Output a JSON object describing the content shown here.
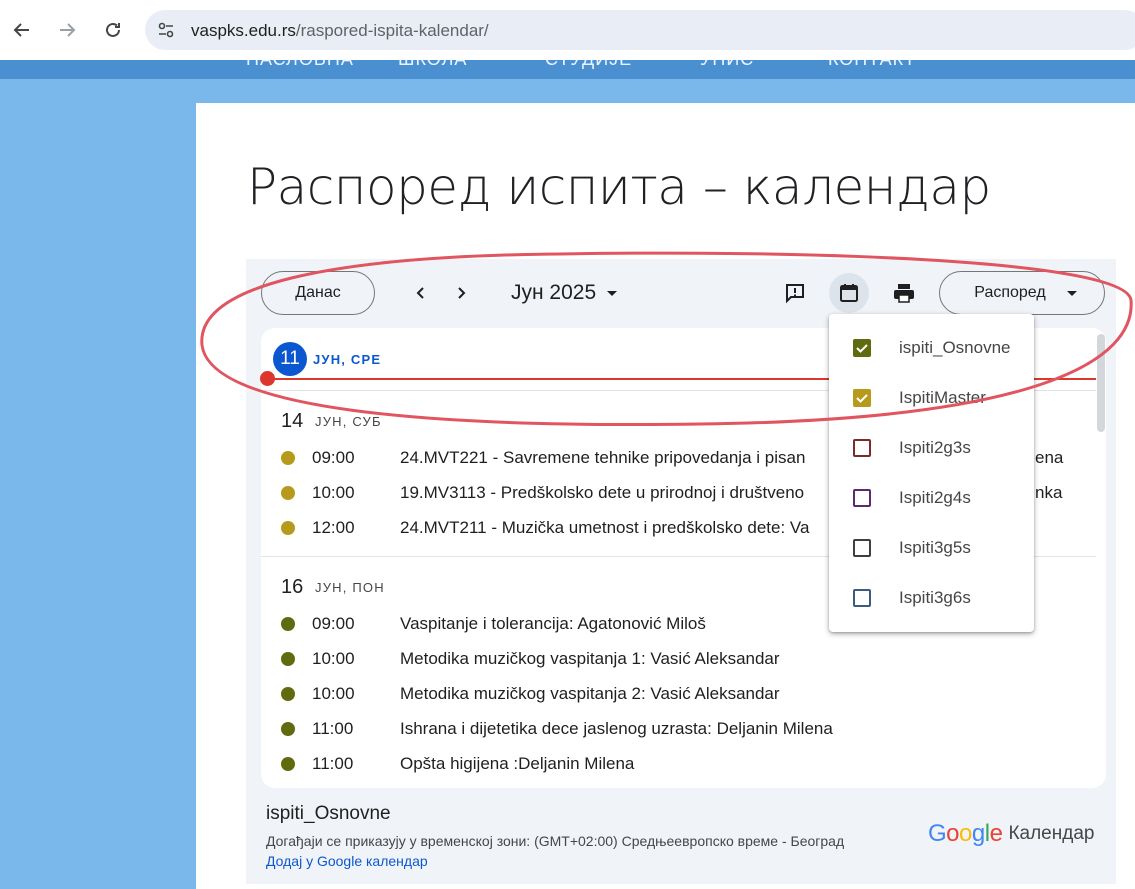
{
  "browser": {
    "url_host": "vaspks.edu.rs",
    "url_path": "/raspored-ispita-kalendar/"
  },
  "site_nav": [
    "НАСЛОВНА",
    "ШКОЛА",
    "СТУДИЈЕ",
    "УПИС",
    "КОНТАКТ"
  ],
  "page": {
    "title": "Распоред испита – календар"
  },
  "calendar": {
    "today_button": "Данас",
    "month": "Јун 2025",
    "view_button": "Распоред",
    "today": {
      "day": "11",
      "label": "ЈУН, СРЕ"
    },
    "days": [
      {
        "day": "14",
        "label": "ЈУН, СУБ",
        "events": [
          {
            "time": "09:00",
            "title": "24.MVT221 - Savremene tehnike pripovedanja i pisan",
            "color": "#b79a1c"
          },
          {
            "time": "10:00",
            "title": "19.MV3113 - Predškolsko dete u prirodnoj i društveno",
            "color": "#b79a1c"
          },
          {
            "time": "12:00",
            "title": "24.MVT211 - Muzička umetnost i predškolsko dete: Va",
            "color": "#b79a1c"
          }
        ]
      },
      {
        "day": "16",
        "label": "ЈУН, ПОН",
        "events": [
          {
            "time": "09:00",
            "title": "Vaspitanje i tolerancija: Agatonović Miloš",
            "color": "#5f6b0e"
          },
          {
            "time": "10:00",
            "title": "Metodika muzičkog vaspitanja 1: Vasić Aleksandar",
            "color": "#5f6b0e"
          },
          {
            "time": "10:00",
            "title": "Metodika muzičkog vaspitanja 2: Vasić Aleksandar",
            "color": "#5f6b0e"
          },
          {
            "time": "11:00",
            "title": "Ishrana i dijetetika dece jaslenog uzrasta: Deljanin Milena",
            "color": "#5f6b0e"
          },
          {
            "time": "11:00",
            "title": "Opšta higijena :Deljanin Milena",
            "color": "#5f6b0e"
          }
        ]
      }
    ],
    "clipped_right_text": [
      "ena",
      "nka"
    ],
    "calendars": [
      {
        "name": "ispiti_Osnovne",
        "checked": true,
        "color": "#5f6b0e"
      },
      {
        "name": "IspitiMaster",
        "checked": true,
        "color": "#b79a1c"
      },
      {
        "name": "Ispiti2g3s",
        "checked": false,
        "color": "#7d2a2a"
      },
      {
        "name": "Ispiti2g4s",
        "checked": false,
        "color": "#5b2a6e"
      },
      {
        "name": "Ispiti3g5s",
        "checked": false,
        "color": "#3c4043"
      },
      {
        "name": "Ispiti3g6s",
        "checked": false,
        "color": "#3d5a80"
      }
    ],
    "footer": {
      "calendar_name": "ispiti_Osnovne",
      "timezone_note": "Догађаји се приказују у временској зони: (GMT+02:00) Средњеевропско време - Београд",
      "add_link": "Додај у Google календар",
      "brand_google": "Google",
      "brand_product": "Календар"
    }
  },
  "colors": {
    "accent_blue": "#0b57d0",
    "now_red": "#dc362e",
    "annotation_red": "#e0555f"
  },
  "icons": [
    "back-arrow-icon",
    "forward-arrow-icon",
    "reload-icon",
    "site-settings-icon",
    "chevron-left-icon",
    "chevron-right-icon",
    "dropdown-arrow-icon",
    "feedback-icon",
    "calendar-icon",
    "print-icon",
    "checkmark-icon"
  ]
}
